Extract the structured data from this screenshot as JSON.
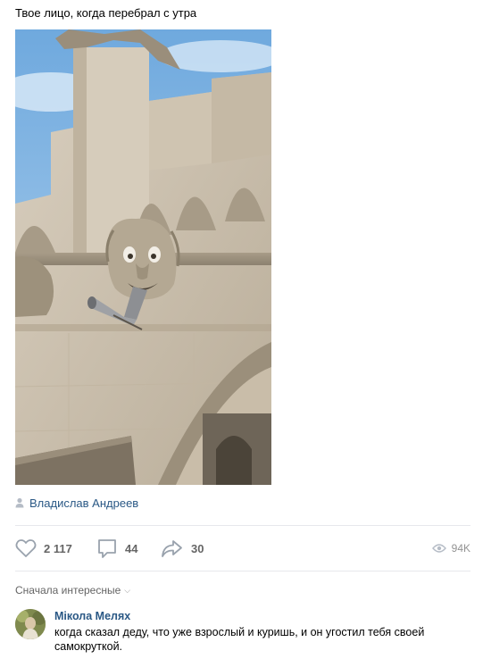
{
  "post": {
    "text": "Твое лицо, когда перебрал с утра",
    "photo_alt": "gargoyle-with-pipe-in-mouth",
    "author": "Владислав Андреев"
  },
  "actions": {
    "likes": "2 117",
    "comments": "44",
    "shares": "30",
    "views": "94K"
  },
  "comments_section": {
    "sort_label": "Сначала интересные",
    "items": [
      {
        "name": "Мікола Меляx",
        "text": "когда сказал деду, что уже взрослый и куришь, и он угостил тебя своей самокруткой."
      }
    ]
  },
  "colors": {
    "link": "#2a5885",
    "muted": "#656565",
    "divider": "#e7e8ec",
    "icon": "#99a2ad"
  }
}
